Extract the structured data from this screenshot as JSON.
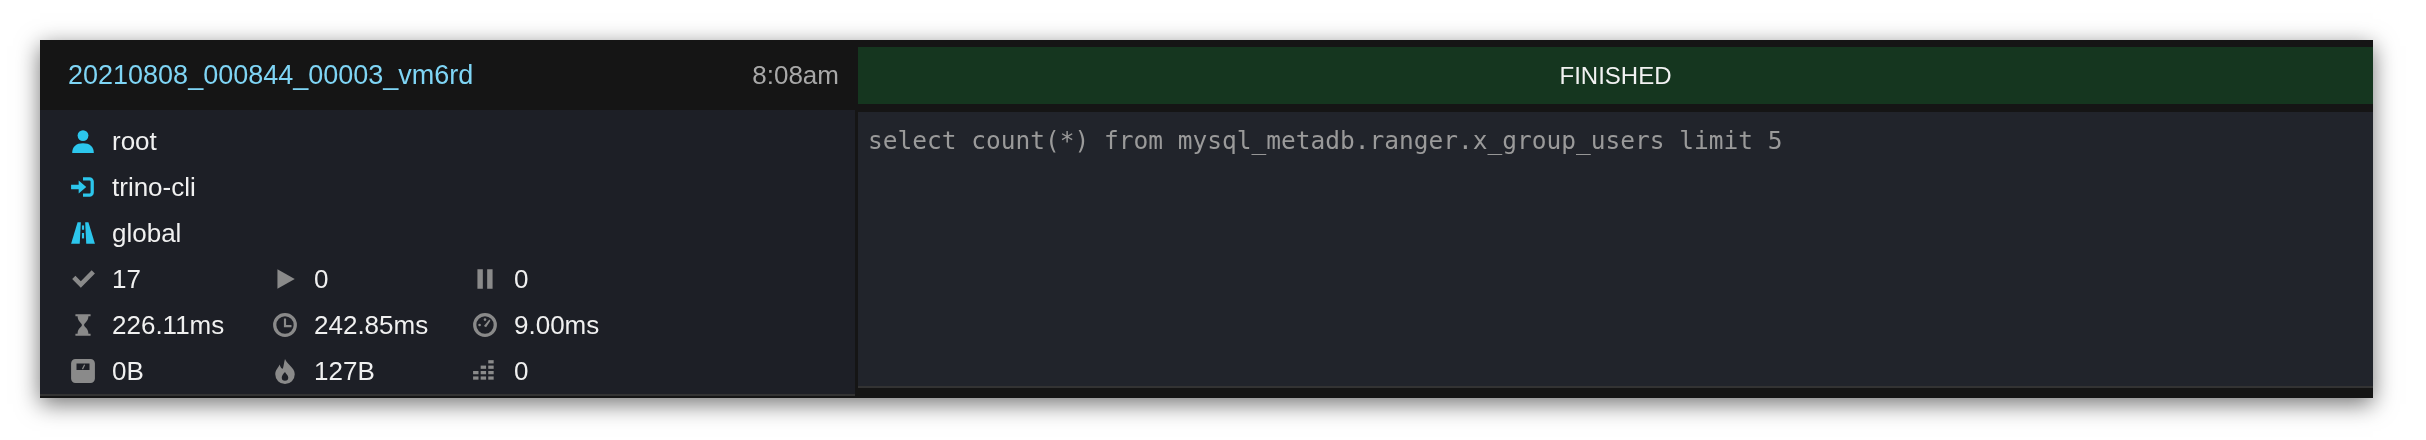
{
  "query": {
    "id": "20210808_000844_00003_vm6rd",
    "time": "8:08am",
    "state": "FINISHED",
    "sql": "select count(*) from mysql_metadb.ranger.x_group_users limit 5"
  },
  "details": [
    {
      "kind": "user",
      "text": "root"
    },
    {
      "kind": "source",
      "text": "trino-cli"
    },
    {
      "kind": "resource",
      "text": "global"
    }
  ],
  "stats": [
    [
      {
        "kind": "completed",
        "text": "17"
      },
      {
        "kind": "running",
        "text": "0"
      },
      {
        "kind": "queued",
        "text": "0"
      }
    ],
    [
      {
        "kind": "elapsed",
        "text": "226.11ms"
      },
      {
        "kind": "cpu",
        "text": "242.85ms"
      },
      {
        "kind": "wait",
        "text": "9.00ms"
      }
    ],
    [
      {
        "kind": "memory",
        "text": "0B"
      },
      {
        "kind": "peak",
        "text": "127B"
      },
      {
        "kind": "splits",
        "text": "0"
      }
    ]
  ]
}
